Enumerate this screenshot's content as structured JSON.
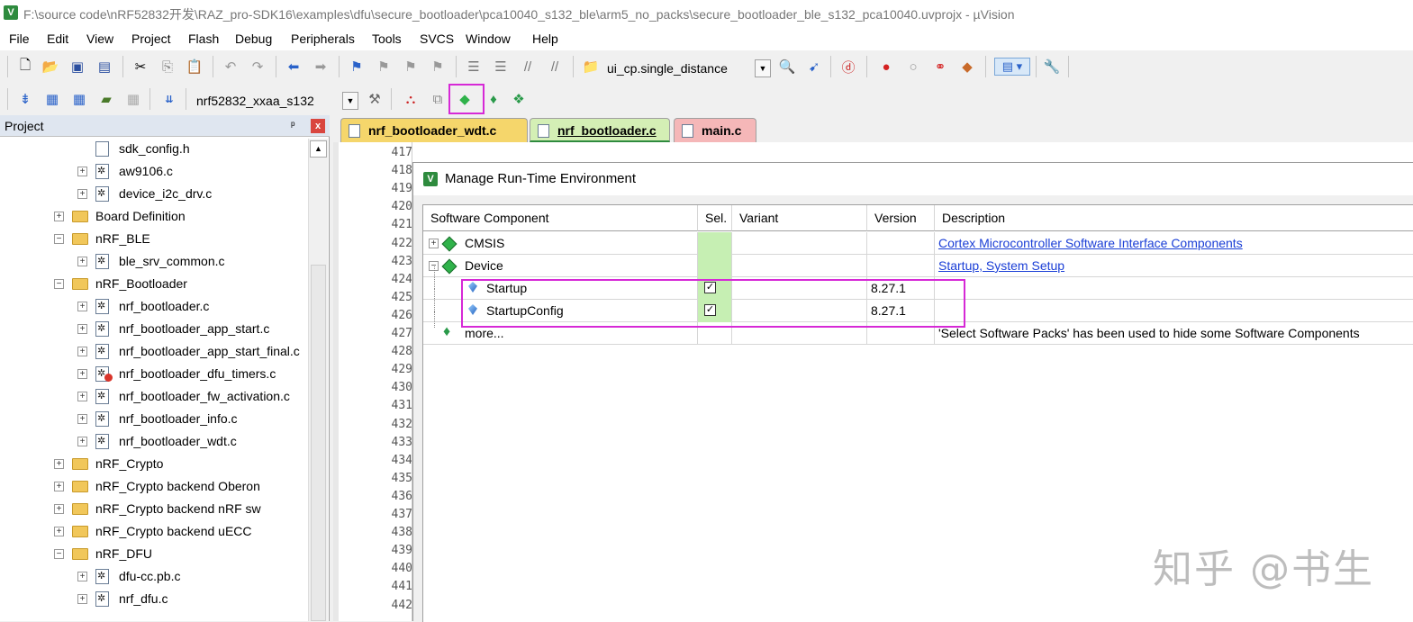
{
  "window": {
    "title": "F:\\source code\\nRF52832开发\\RAZ_pro-SDK16\\examples\\dfu\\secure_bootloader\\pca10040_s132_ble\\arm5_no_packs\\secure_bootloader_ble_s132_pca10040.uvprojx - µVision",
    "app_icon": "V"
  },
  "menu": [
    "File",
    "Edit",
    "View",
    "Project",
    "Flash",
    "Debug",
    "Peripherals",
    "Tools",
    "SVCS",
    "Window",
    "Help"
  ],
  "toolbar1": {
    "find_combo_value": "ui_cp.single_distance"
  },
  "toolbar2": {
    "target_combo_value": "nrf52832_xxaa_s132"
  },
  "project_panel": {
    "title": "Project",
    "pin": "ᵖ",
    "close": "x",
    "tree": [
      {
        "type": "file",
        "label": "sdk_config.h",
        "indent": 2,
        "expander": false
      },
      {
        "type": "cfile",
        "label": "aw9106.c",
        "indent": 2,
        "expander": true
      },
      {
        "type": "cfile",
        "label": "device_i2c_drv.c",
        "indent": 2,
        "expander": true
      },
      {
        "type": "folder",
        "label": "Board Definition",
        "indent": 1,
        "expander": true
      },
      {
        "type": "folder",
        "label": "nRF_BLE",
        "indent": 1,
        "expander": true
      },
      {
        "type": "cfile",
        "label": "ble_srv_common.c",
        "indent": 2,
        "expander": true
      },
      {
        "type": "folder",
        "label": "nRF_Bootloader",
        "indent": 1,
        "expander": true
      },
      {
        "type": "cfile",
        "label": "nrf_bootloader.c",
        "indent": 2,
        "expander": true
      },
      {
        "type": "cfile",
        "label": "nrf_bootloader_app_start.c",
        "indent": 2,
        "expander": true
      },
      {
        "type": "cfile",
        "label": "nrf_bootloader_app_start_final.c",
        "indent": 2,
        "expander": true
      },
      {
        "type": "cfile-err",
        "label": "nrf_bootloader_dfu_timers.c",
        "indent": 2,
        "expander": true
      },
      {
        "type": "cfile",
        "label": "nrf_bootloader_fw_activation.c",
        "indent": 2,
        "expander": true
      },
      {
        "type": "cfile",
        "label": "nrf_bootloader_info.c",
        "indent": 2,
        "expander": true
      },
      {
        "type": "cfile",
        "label": "nrf_bootloader_wdt.c",
        "indent": 2,
        "expander": true
      },
      {
        "type": "folder",
        "label": "nRF_Crypto",
        "indent": 1,
        "expander": true
      },
      {
        "type": "folder",
        "label": "nRF_Crypto backend Oberon",
        "indent": 1,
        "expander": true
      },
      {
        "type": "folder",
        "label": "nRF_Crypto backend nRF sw",
        "indent": 1,
        "expander": true
      },
      {
        "type": "folder",
        "label": "nRF_Crypto backend uECC",
        "indent": 1,
        "expander": true
      },
      {
        "type": "folder",
        "label": "nRF_DFU",
        "indent": 1,
        "expander": true
      },
      {
        "type": "cfile",
        "label": "dfu-cc.pb.c",
        "indent": 2,
        "expander": true
      },
      {
        "type": "cfile",
        "label": "nrf_dfu.c",
        "indent": 2,
        "expander": true
      }
    ]
  },
  "tabs": [
    {
      "label": "nrf_bootloader_wdt.c",
      "color": "#f5d66b"
    },
    {
      "label": "nrf_bootloader.c",
      "color": "#d4efb5"
    },
    {
      "label": "main.c",
      "color": "#f5b7b8"
    }
  ],
  "editor": {
    "line_numbers": [
      "417",
      "418",
      "419",
      "420",
      "421",
      "422",
      "423",
      "424",
      "425",
      "426",
      "427",
      "428",
      "429",
      "430",
      "431",
      "432",
      "433",
      "434",
      "435",
      "436",
      "437",
      "438",
      "439",
      "440",
      "441",
      "442"
    ]
  },
  "rte_dialog": {
    "title": "Manage Run-Time Environment",
    "columns": [
      "Software Component",
      "Sel.",
      "Variant",
      "Version",
      "Description"
    ],
    "rows": [
      {
        "name": "CMSIS",
        "sel": "",
        "variant": "",
        "version": "",
        "description": "Cortex Microcontroller Software Interface Components"
      },
      {
        "name": "Device",
        "sel": "",
        "variant": "",
        "version": "",
        "description": "Startup, System Setup"
      },
      {
        "name": "Startup",
        "sel": "✓",
        "variant": "",
        "version": "8.27.1",
        "description": ""
      },
      {
        "name": "StartupConfig",
        "sel": "✓",
        "variant": "",
        "version": "8.27.1",
        "description": ""
      },
      {
        "name": "more...",
        "sel": "",
        "variant": "",
        "version": "",
        "description": "'Select Software Packs' has been used to hide some Software Components"
      }
    ]
  },
  "watermark": "知乎 @书生",
  "colors": {
    "highlight_box": "#d629d6",
    "selected_row": "#3399ff",
    "sel_green": "#c6efb3"
  }
}
